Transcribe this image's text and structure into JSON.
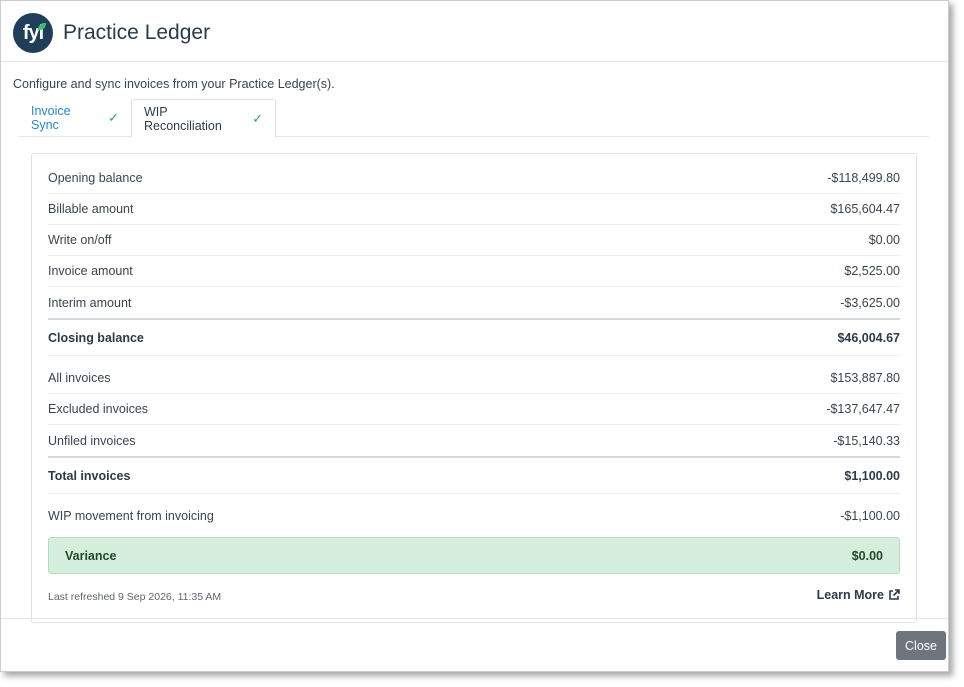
{
  "header": {
    "logo_text": "fyi",
    "title": "Practice Ledger"
  },
  "subtitle": "Configure and sync invoices from your Practice Ledger(s).",
  "tabs": [
    {
      "label": "Invoice Sync",
      "icon": "check-icon"
    },
    {
      "label": "WIP Reconciliation",
      "icon": "check-icon"
    }
  ],
  "rows": [
    {
      "label": "Opening balance",
      "value": "-$118,499.80"
    },
    {
      "label": "Billable amount",
      "value": "$165,604.47"
    },
    {
      "label": "Write on/off",
      "value": "$0.00"
    },
    {
      "label": "Invoice amount",
      "value": "$2,525.00"
    },
    {
      "label": "Interim amount",
      "value": "-$3,625.00"
    },
    {
      "label": "Closing balance",
      "value": "$46,004.67"
    },
    {
      "label": "All invoices",
      "value": "$153,887.80"
    },
    {
      "label": "Excluded invoices",
      "value": "-$137,647.47"
    },
    {
      "label": "Unfiled invoices",
      "value": "-$15,140.33"
    },
    {
      "label": "Total invoices",
      "value": "$1,100.00"
    },
    {
      "label": "WIP movement from invoicing",
      "value": "-$1,100.00"
    }
  ],
  "variance": {
    "label": "Variance",
    "value": "$0.00"
  },
  "last_refreshed": "Last refreshed 9 Sep 2026, 11:35 AM",
  "learn_more": "Learn More",
  "close_label": "Close",
  "colors": {
    "accent": "#2a86c9",
    "success": "#2fa84f",
    "variance_bg": "#d6efdc",
    "brand": "#1f3e5a"
  }
}
